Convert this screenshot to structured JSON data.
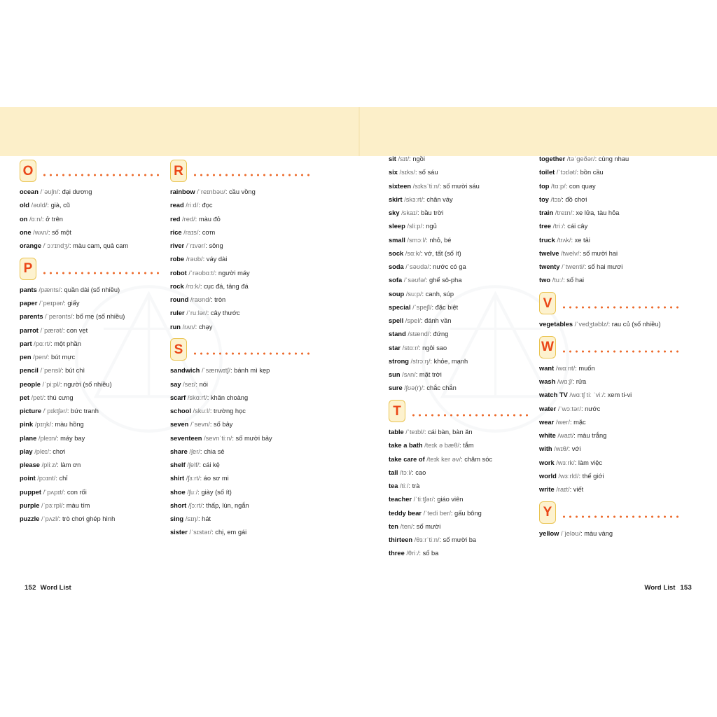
{
  "document": {
    "footer_left": {
      "page": "152",
      "label": "Word List"
    },
    "footer_right": {
      "page": "153",
      "label": "Word List"
    }
  },
  "colors": {
    "band": "#fcefc9",
    "badge_fill": "#fdf2cf",
    "badge_border": "#eac451",
    "badge_letter": "#ea4618",
    "dots": "#ec6a2b",
    "text": "#2b2b2b",
    "ipa": "#6f6f6f"
  },
  "columns": [
    {
      "id": "column-1",
      "sections": [
        {
          "letter": "O",
          "entries": [
            {
              "word": "ocean",
              "ipa": "/ˈəʊʃn/",
              "def": ": đại dương"
            },
            {
              "word": "old",
              "ipa": "/əʊld/",
              "def": ": già, cũ"
            },
            {
              "word": "on",
              "ipa": "/ɑːn/",
              "def": ": ở trên"
            },
            {
              "word": "one",
              "ipa": "/wʌn/",
              "def": ": số một"
            },
            {
              "word": "orange",
              "ipa": "/ˈɔːrɪndʒ/",
              "def": ": màu cam, quả cam"
            }
          ]
        },
        {
          "letter": "P",
          "entries": [
            {
              "word": "pants",
              "ipa": "/pænts/",
              "def": ": quần dài (số nhiều)"
            },
            {
              "word": "paper",
              "ipa": "/ˈpeɪpər/",
              "def": ": giấy"
            },
            {
              "word": "parents",
              "ipa": "/ˈperənts/",
              "def": ": bố mẹ (số nhiều)"
            },
            {
              "word": "parrot",
              "ipa": "/ˈpærət/",
              "def": ": con vẹt"
            },
            {
              "word": "part",
              "ipa": "/pɑːrt/",
              "def": ": một phần"
            },
            {
              "word": "pen",
              "ipa": "/pen/",
              "def": ": bút mực"
            },
            {
              "word": "pencil",
              "ipa": "/ˈpensl/",
              "def": ": bút chì"
            },
            {
              "word": "people",
              "ipa": "/ˈpiːpl/",
              "def": ": người (số nhiều)"
            },
            {
              "word": "pet",
              "ipa": "/pet/",
              "def": ": thú cưng"
            },
            {
              "word": "picture",
              "ipa": "/ˈpɪktʃər/",
              "def": ": bức tranh"
            },
            {
              "word": "pink",
              "ipa": "/pɪŋk/",
              "def": ": màu hồng"
            },
            {
              "word": "plane",
              "ipa": "/pleɪn/",
              "def": ": máy bay"
            },
            {
              "word": "play",
              "ipa": "/pleɪ/",
              "def": ": chơi"
            },
            {
              "word": "please",
              "ipa": "/pliːz/",
              "def": ": làm ơn"
            },
            {
              "word": "point",
              "ipa": "/pɔɪnt/",
              "def": ": chỉ"
            },
            {
              "word": "puppet",
              "ipa": "/ˈpʌpɪt/",
              "def": ": con rối"
            },
            {
              "word": "purple",
              "ipa": "/ˈpɜːrpl/",
              "def": ": màu tím"
            },
            {
              "word": "puzzle",
              "ipa": "/ˈpʌzl/",
              "def": ": trò chơi ghép hình"
            }
          ]
        }
      ]
    },
    {
      "id": "column-2",
      "sections": [
        {
          "letter": "R",
          "entries": [
            {
              "word": "rainbow",
              "ipa": "/ˈreɪnbəʊ/",
              "def": ": cầu vồng"
            },
            {
              "word": "read",
              "ipa": "/riːd/",
              "def": ": đọc"
            },
            {
              "word": "red",
              "ipa": "/red/",
              "def": ": màu đỏ"
            },
            {
              "word": "rice",
              "ipa": "/raɪs/",
              "def": ": cơm"
            },
            {
              "word": "river",
              "ipa": "/ˈrɪvər/",
              "def": ": sông"
            },
            {
              "word": "robe",
              "ipa": "/rəʊb/",
              "def": ": váy dài"
            },
            {
              "word": "robot",
              "ipa": "/ˈrəʊbɑːt/",
              "def": ": người máy"
            },
            {
              "word": "rock",
              "ipa": "/rɑːk/",
              "def": ": cục đá, tảng đá"
            },
            {
              "word": "round",
              "ipa": "/raʊnd/",
              "def": ": tròn"
            },
            {
              "word": "ruler",
              "ipa": "/ˈruːlər/",
              "def": ": cây thước"
            },
            {
              "word": "run",
              "ipa": "/rʌn/",
              "def": ": chạy"
            }
          ]
        },
        {
          "letter": "S",
          "entries": [
            {
              "word": "sandwich",
              "ipa": "/ˈsænwɪtʃ/",
              "def": ": bánh mì kẹp"
            },
            {
              "word": "say",
              "ipa": "/seɪ/",
              "def": ": nói"
            },
            {
              "word": "scarf",
              "ipa": "/skɑːrf/",
              "def": ": khăn choàng"
            },
            {
              "word": "school",
              "ipa": "/skuːl/",
              "def": ": trường học"
            },
            {
              "word": "seven",
              "ipa": "/ˈsevn/",
              "def": ": số bảy"
            },
            {
              "word": "seventeen",
              "ipa": "/sevnˈtiːn/",
              "def": ": số mười bảy"
            },
            {
              "word": "share",
              "ipa": "/ʃer/",
              "def": ": chia sẻ"
            },
            {
              "word": "shelf",
              "ipa": "/ʃelf/",
              "def": ": cái kệ"
            },
            {
              "word": "shirt",
              "ipa": "/ʃɜːrt/",
              "def": ": áo sơ mi"
            },
            {
              "word": "shoe",
              "ipa": "/ʃuː/",
              "def": ": giày (số ít)"
            },
            {
              "word": "short",
              "ipa": "/ʃɔːrt/",
              "def": ": thấp, lùn, ngắn"
            },
            {
              "word": "sing",
              "ipa": "/sɪŋ/",
              "def": ": hát"
            },
            {
              "word": "sister",
              "ipa": "/ˈsɪstər/",
              "def": ": chị, em gái"
            }
          ]
        }
      ]
    },
    {
      "id": "column-3",
      "sections": [
        {
          "letter": "",
          "entries": [
            {
              "word": "sit",
              "ipa": "/sɪt/",
              "def": ": ngồi"
            },
            {
              "word": "six",
              "ipa": "/sɪks/",
              "def": ": số sáu"
            },
            {
              "word": "sixteen",
              "ipa": "/sɪksˈtiːn/",
              "def": ": số mười sáu"
            },
            {
              "word": "skirt",
              "ipa": "/skɜːrt/",
              "def": ": chân váy"
            },
            {
              "word": "sky",
              "ipa": "/skaɪ/",
              "def": ": bầu trời"
            },
            {
              "word": "sleep",
              "ipa": "/sliːp/",
              "def": ": ngủ"
            },
            {
              "word": "small",
              "ipa": "/smɔːl/",
              "def": ": nhỏ, bé"
            },
            {
              "word": "sock",
              "ipa": "/sɑːk/",
              "def": ": vớ, tất (số ít)"
            },
            {
              "word": "soda",
              "ipa": "/ˈsəʊdə/",
              "def": ": nước có ga"
            },
            {
              "word": "sofa",
              "ipa": "/ˈsəʊfə/",
              "def": ": ghế sô-pha"
            },
            {
              "word": "soup",
              "ipa": "/suːp/",
              "def": ": canh, súp"
            },
            {
              "word": "special",
              "ipa": "/ˈspeʃl/",
              "def": ": đặc biệt"
            },
            {
              "word": "spell",
              "ipa": "/spel/",
              "def": ": đánh vần"
            },
            {
              "word": "stand",
              "ipa": "/stænd/",
              "def": ": đứng"
            },
            {
              "word": "star",
              "ipa": "/stɑːr/",
              "def": ": ngôi sao"
            },
            {
              "word": "strong",
              "ipa": "/strɔːŋ/",
              "def": ": khỏe, mạnh"
            },
            {
              "word": "sun",
              "ipa": "/sʌn/",
              "def": ": mặt trời"
            },
            {
              "word": "sure",
              "ipa": "/ʃʊə(r)/",
              "def": ": chắc chắn"
            }
          ]
        },
        {
          "letter": "T",
          "entries": [
            {
              "word": "table",
              "ipa": "/ˈteɪbl/",
              "def": ": cái bàn, bàn ăn"
            },
            {
              "word": "take a bath",
              "ipa": "/teɪk ə bæθ/",
              "def": ": tắm"
            },
            {
              "word": "take care of",
              "ipa": "/teɪk ker əv/",
              "def": ": chăm sóc"
            },
            {
              "word": "tall",
              "ipa": "/tɔːl/",
              "def": ": cao"
            },
            {
              "word": "tea",
              "ipa": "/tiː/",
              "def": ": trà"
            },
            {
              "word": "teacher",
              "ipa": "/ˈtiːtʃər/",
              "def": ": giáo viên"
            },
            {
              "word": "teddy bear",
              "ipa": "/ˈtedi ber/",
              "def": ": gấu bông"
            },
            {
              "word": "ten",
              "ipa": "/ten/",
              "def": ": số mười"
            },
            {
              "word": "thirteen",
              "ipa": "/θɜːrˈtiːn/",
              "def": ": số mười ba"
            },
            {
              "word": "three",
              "ipa": "/θriː/",
              "def": ": số ba"
            }
          ]
        }
      ]
    },
    {
      "id": "column-4",
      "sections": [
        {
          "letter": "",
          "entries": [
            {
              "word": "together",
              "ipa": "/təˈɡeðər/",
              "def": ": cùng nhau"
            },
            {
              "word": "toilet",
              "ipa": "/ˈtɔɪlət/",
              "def": ": bồn cầu"
            },
            {
              "word": "top",
              "ipa": "/tɑːp/",
              "def": ": con quay"
            },
            {
              "word": "toy",
              "ipa": "/tɔɪ/",
              "def": ": đồ chơi"
            },
            {
              "word": "train",
              "ipa": "/treɪn/",
              "def": ": xe lửa, tàu hỏa"
            },
            {
              "word": "tree",
              "ipa": "/triː/",
              "def": ": cái cây"
            },
            {
              "word": "truck",
              "ipa": "/trʌk/",
              "def": ": xe tải"
            },
            {
              "word": "twelve",
              "ipa": "/twelv/",
              "def": ": số mười hai"
            },
            {
              "word": "twenty",
              "ipa": "/ˈtwenti/",
              "def": ": số hai mươi"
            },
            {
              "word": "two",
              "ipa": "/tuː/",
              "def": ": số hai"
            }
          ]
        },
        {
          "letter": "V",
          "entries": [
            {
              "word": "vegetables",
              "ipa": "/ˈvedʒtəblz/",
              "def": ": rau củ (số nhiều)"
            }
          ]
        },
        {
          "letter": "W",
          "entries": [
            {
              "word": "want",
              "ipa": "/wɑːnt/",
              "def": ": muốn"
            },
            {
              "word": "wash",
              "ipa": "/wɑːʃ/",
              "def": ": rửa"
            },
            {
              "word": "watch TV",
              "ipa": "/wɑːtʃ tiː ˈviː/",
              "def": ": xem ti-vi"
            },
            {
              "word": "water",
              "ipa": "/ˈwɔːtər/",
              "def": ": nước"
            },
            {
              "word": "wear",
              "ipa": "/wer/",
              "def": ": mặc"
            },
            {
              "word": "white",
              "ipa": "/waɪt/",
              "def": ": màu trắng"
            },
            {
              "word": "with",
              "ipa": "/wɪθ/",
              "def": ": với"
            },
            {
              "word": "work",
              "ipa": "/wɜːrk/",
              "def": ": làm việc"
            },
            {
              "word": "world",
              "ipa": "/wɜːrld/",
              "def": ": thế giới"
            },
            {
              "word": "write",
              "ipa": "/raɪt/",
              "def": ": viết"
            }
          ]
        },
        {
          "letter": "Y",
          "entries": [
            {
              "word": "yellow",
              "ipa": "/ˈjeləʊ/",
              "def": ": màu vàng"
            }
          ]
        }
      ]
    }
  ]
}
